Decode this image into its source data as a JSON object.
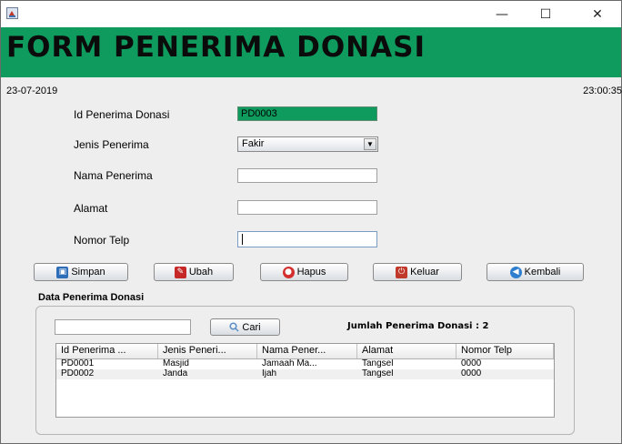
{
  "window": {
    "minimize": "—",
    "maximize": "☐",
    "close": "✕"
  },
  "header": {
    "title": "FORM PENERIMA DONASI"
  },
  "status": {
    "date": "23-07-2019",
    "time": "23:00:35"
  },
  "form": {
    "id_label": "Id Penerima Donasi",
    "id_value": "PD0003",
    "jenis_label": "Jenis Penerima",
    "jenis_value": "Fakir",
    "nama_label": "Nama Penerima",
    "nama_value": "",
    "alamat_label": "Alamat",
    "alamat_value": "",
    "telp_label": "Nomor Telp",
    "telp_value": ""
  },
  "buttons": {
    "simpan": "Simpan",
    "ubah": "Ubah",
    "hapus": "Hapus",
    "keluar": "Keluar",
    "kembali": "Kembali"
  },
  "data_panel": {
    "title": "Data Penerima Donasi",
    "search_value": "",
    "cari": "Cari",
    "jumlah": "Jumlah Penerima Donasi :  2"
  },
  "table": {
    "columns": [
      "Id Penerima ...",
      "Jenis Peneri...",
      "Nama Pener...",
      "Alamat",
      "Nomor Telp"
    ],
    "rows": [
      [
        "PD0001",
        "Masjid",
        "Jamaah Ma...",
        "Tangsel",
        "0000"
      ],
      [
        "PD0002",
        "Janda",
        "Ijah",
        "Tangsel",
        "0000"
      ]
    ]
  },
  "colors": {
    "header_green": "#0f9a5e"
  }
}
